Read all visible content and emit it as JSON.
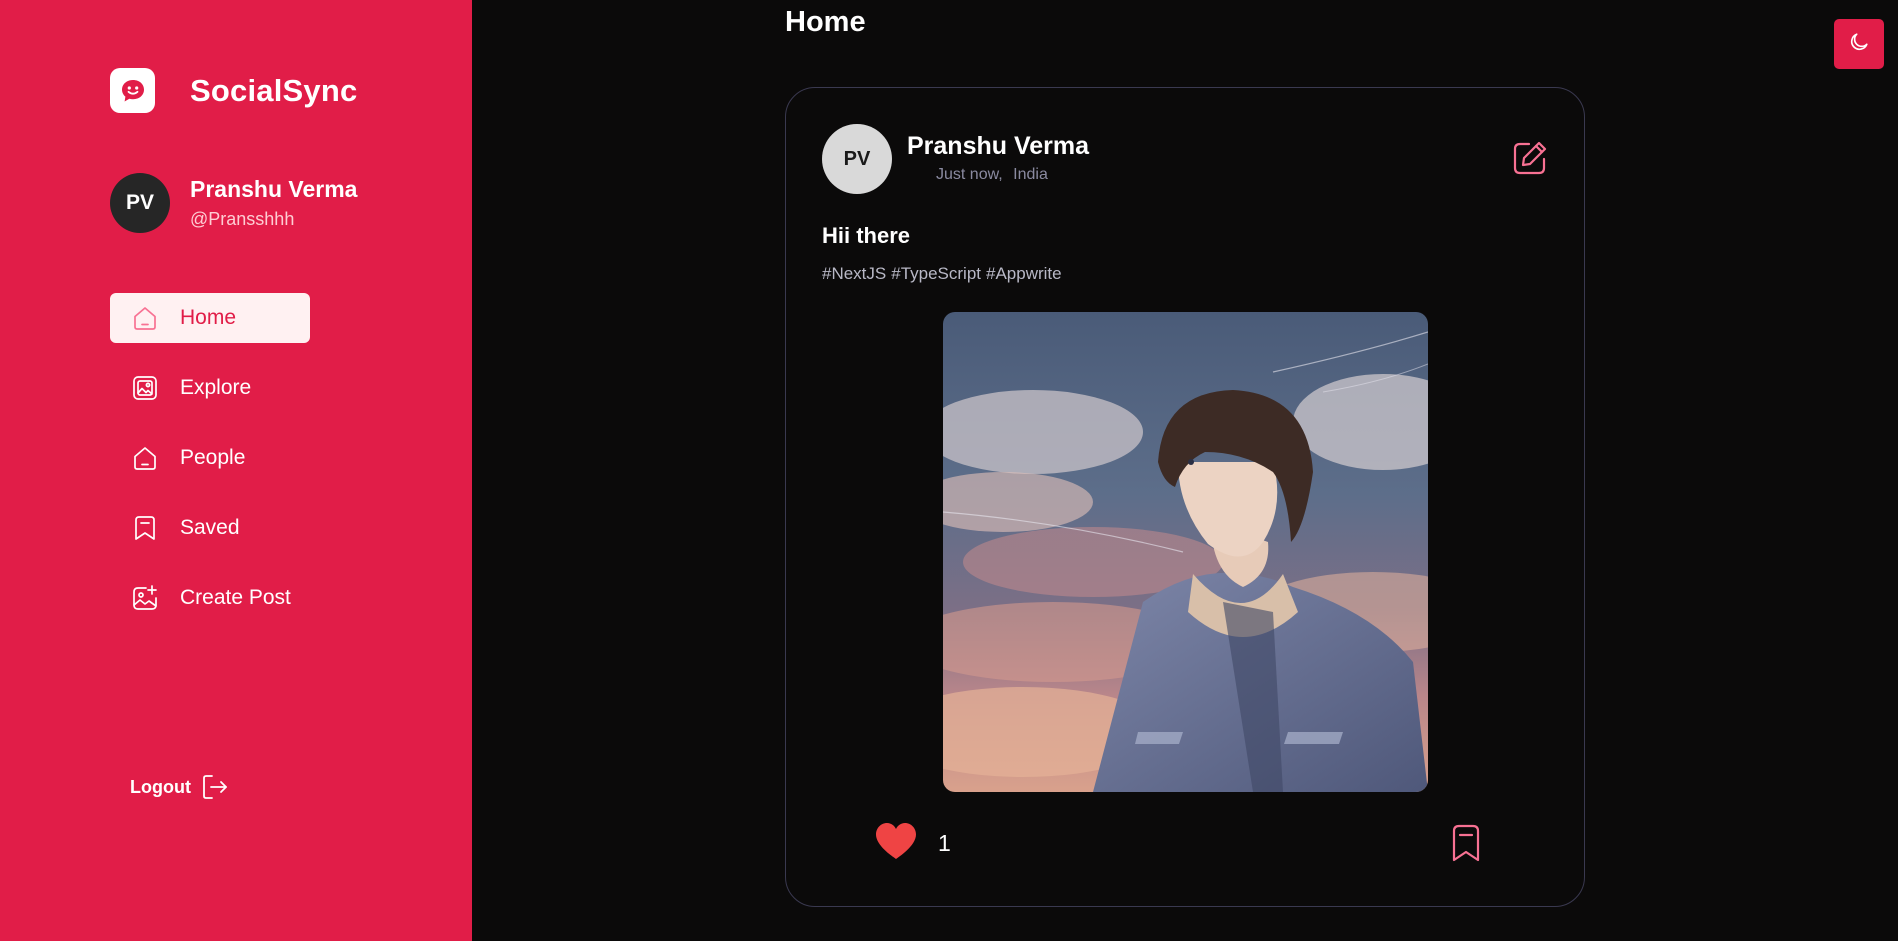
{
  "app": {
    "name": "SocialSync",
    "accent": "#e11d48"
  },
  "user": {
    "initials": "PV",
    "name": "Pranshu Verma",
    "handle": "@Pransshhh"
  },
  "nav": {
    "items": [
      {
        "label": "Home",
        "icon": "home-icon",
        "active": true
      },
      {
        "label": "Explore",
        "icon": "gallery-icon",
        "active": false
      },
      {
        "label": "People",
        "icon": "people-icon",
        "active": false
      },
      {
        "label": "Saved",
        "icon": "bookmark-icon",
        "active": false
      },
      {
        "label": "Create Post",
        "icon": "image-add-icon",
        "active": false
      }
    ],
    "logout_label": "Logout"
  },
  "page": {
    "title": "Home"
  },
  "theme_toggle": {
    "icon": "moon-icon"
  },
  "post": {
    "author_initials": "PV",
    "author": "Pranshu Verma",
    "time": "Just now,",
    "location": "India",
    "caption": "Hii there",
    "tags": [
      "#NextJS",
      "#TypeScript",
      "#Appwrite"
    ],
    "image": "anime-boy-sky-illustration",
    "likes": "1",
    "liked": true
  }
}
